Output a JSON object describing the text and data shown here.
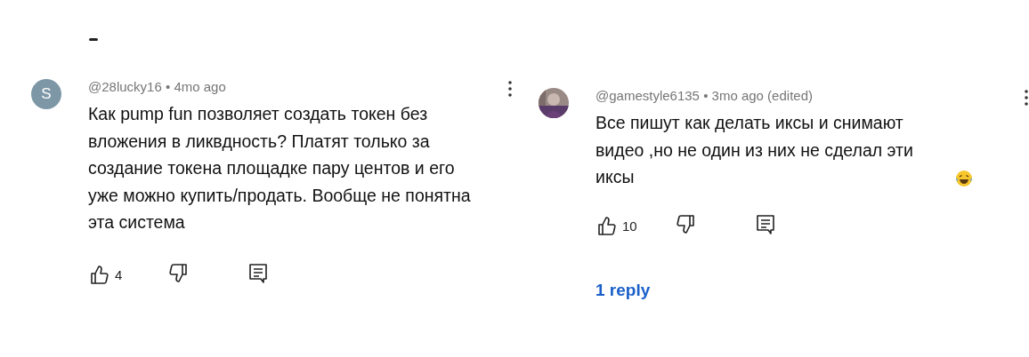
{
  "comments": [
    {
      "avatar": {
        "kind": "letter",
        "letter": "S",
        "color": "#7d97a6"
      },
      "author": "@28lucky16",
      "separator": "•",
      "time": "4mo ago",
      "text": "Как pump fun позволяет создать токен без вложения в ликвдность? Платят только за создание токена площадке пару центов и его уже можно купить/продать. Вообще не понятна эта система",
      "likes": "4"
    },
    {
      "author": "@gamestyle6135",
      "separator": "•",
      "time": "3mo ago (edited)",
      "text": "Все пишут как делать иксы и снимают видео ,но не один из них не сделал эти иксы",
      "emoji": true,
      "likes": "10",
      "replies": "1 reply"
    }
  ]
}
